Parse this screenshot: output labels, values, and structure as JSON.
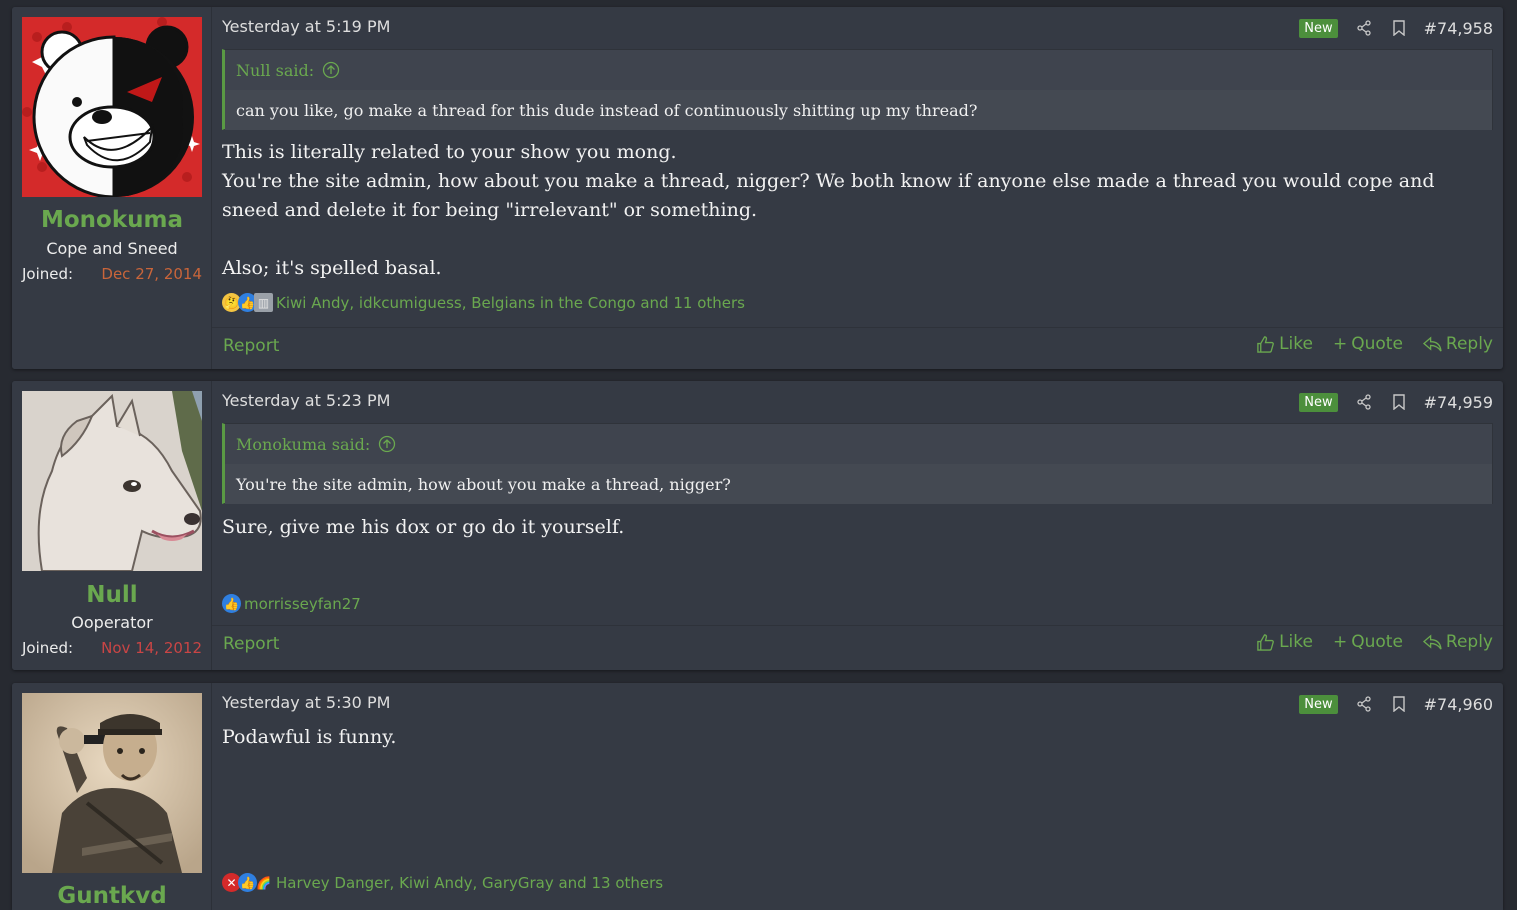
{
  "posts": [
    {
      "author": "Monokuma",
      "user_title": "Cope and Sneed",
      "joined_label": "Joined:",
      "joined_date": "Dec 27, 2014",
      "timestamp": "Yesterday at 5:19 PM",
      "new_label": "New",
      "post_number": "#74,958",
      "quote_author": "Null said:",
      "quote_text": "can you like, go make a thread for this dude instead of continuously shitting up my thread?",
      "body": [
        "This is literally related to your show you mong.",
        "You're the site admin, how about you make a thread, nigger? We both know if anyone else made a thread you would cope and sneed and delete it for being \"irrelevant\" or something.",
        "",
        "Also; it's spelled basal."
      ],
      "reactions_text": "Kiwi Andy, idkcumiguess, Belgians in the Congo and 11 others",
      "report_label": "Report",
      "like_label": "Like",
      "quote_label": "Quote",
      "reply_label": "Reply"
    },
    {
      "author": "Null",
      "user_title": "Ooperator",
      "joined_label": "Joined:",
      "joined_date": "Nov 14, 2012",
      "timestamp": "Yesterday at 5:23 PM",
      "new_label": "New",
      "post_number": "#74,959",
      "quote_author": "Monokuma said:",
      "quote_text": "You're the site admin, how about you make a thread, nigger?",
      "body": [
        "Sure, give me his dox or go do it yourself."
      ],
      "reactions_text": "morrisseyfan27",
      "report_label": "Report",
      "like_label": "Like",
      "quote_label": "Quote",
      "reply_label": "Reply"
    },
    {
      "author": "Guntkvd",
      "timestamp": "Yesterday at 5:30 PM",
      "new_label": "New",
      "post_number": "#74,960",
      "body": [
        "Podawful is funny."
      ],
      "reactions_text": "Harvey Danger, Kiwi Andy, GaryGray and 13 others"
    }
  ],
  "colors": {
    "accent_green": "#6aa84f",
    "joined_orange": "#c9653a",
    "joined_red": "#c94545",
    "badge_green": "#4c8f3c"
  }
}
